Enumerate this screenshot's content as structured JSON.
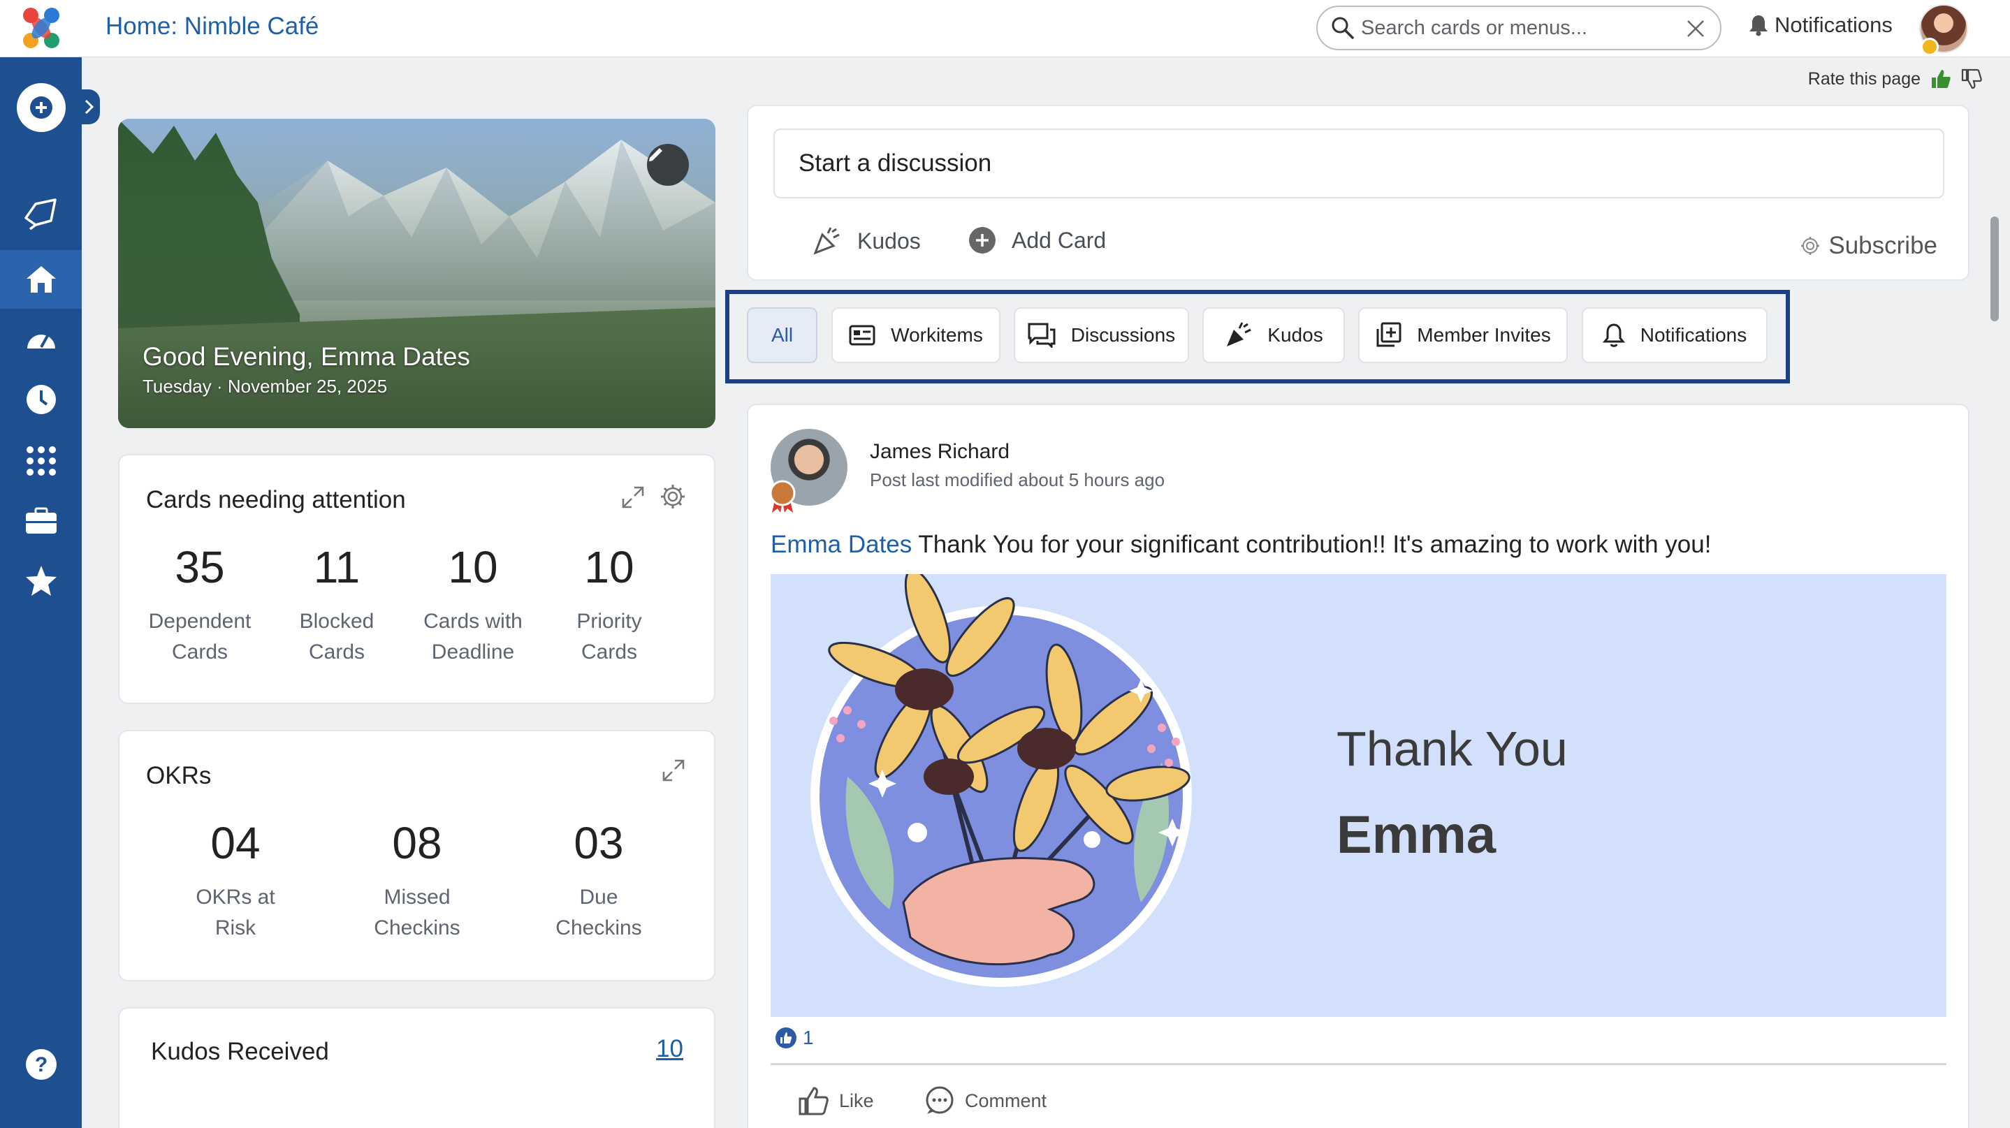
{
  "header": {
    "title": "Home: Nimble Café",
    "search_placeholder": "Search cards or menus...",
    "notifications_label": "Notifications"
  },
  "rate": {
    "label": "Rate this page"
  },
  "nav": {
    "items": [
      "add-icon",
      "nimble-icon",
      "home-icon",
      "dashboard-icon",
      "clock-icon",
      "apps-icon",
      "briefcase-icon",
      "star-icon",
      "help-icon"
    ],
    "active": "home-icon"
  },
  "hero": {
    "greeting": "Good Evening, Emma Dates",
    "date": "Tuesday · November 25, 2025"
  },
  "attention": {
    "title": "Cards needing attention",
    "metrics": [
      {
        "value": "35",
        "label_1": "Dependent",
        "label_2": "Cards"
      },
      {
        "value": "11",
        "label_1": "Blocked",
        "label_2": "Cards"
      },
      {
        "value": "10",
        "label_1": "Cards with",
        "label_2": "Deadline"
      },
      {
        "value": "10",
        "label_1": "Priority",
        "label_2": "Cards"
      }
    ]
  },
  "okrs": {
    "title": "OKRs",
    "metrics": [
      {
        "value": "04",
        "label_1": "OKRs at",
        "label_2": "Risk"
      },
      {
        "value": "08",
        "label_1": "Missed",
        "label_2": "Checkins"
      },
      {
        "value": "03",
        "label_1": "Due",
        "label_2": "Checkins"
      }
    ]
  },
  "kudos_received": {
    "title": "Kudos Received",
    "count": "10"
  },
  "composer": {
    "placeholder": "Start a discussion",
    "kudos_label": "Kudos",
    "add_card_label": "Add Card",
    "subscribe_label": "Subscribe"
  },
  "filters": {
    "tabs": [
      "All",
      "Workitems",
      "Discussions",
      "Kudos",
      "Member Invites",
      "Notifications"
    ],
    "active": "All"
  },
  "post": {
    "author": "James Richard",
    "meta": "Post last modified about 5 hours ago",
    "mention": "Emma Dates",
    "message": " Thank You for your significant contribution!! It's amazing to work with you!",
    "image_line_1": "Thank You",
    "image_line_2": "Emma",
    "likes": "1",
    "like_label": "Like",
    "comment_label": "Comment"
  },
  "colors": {
    "nav_bg": "#1e4f91",
    "accent": "#1f5fa8",
    "highlight_border": "#1c3f8c",
    "kudos_image_bg": "#d3e0fb"
  }
}
